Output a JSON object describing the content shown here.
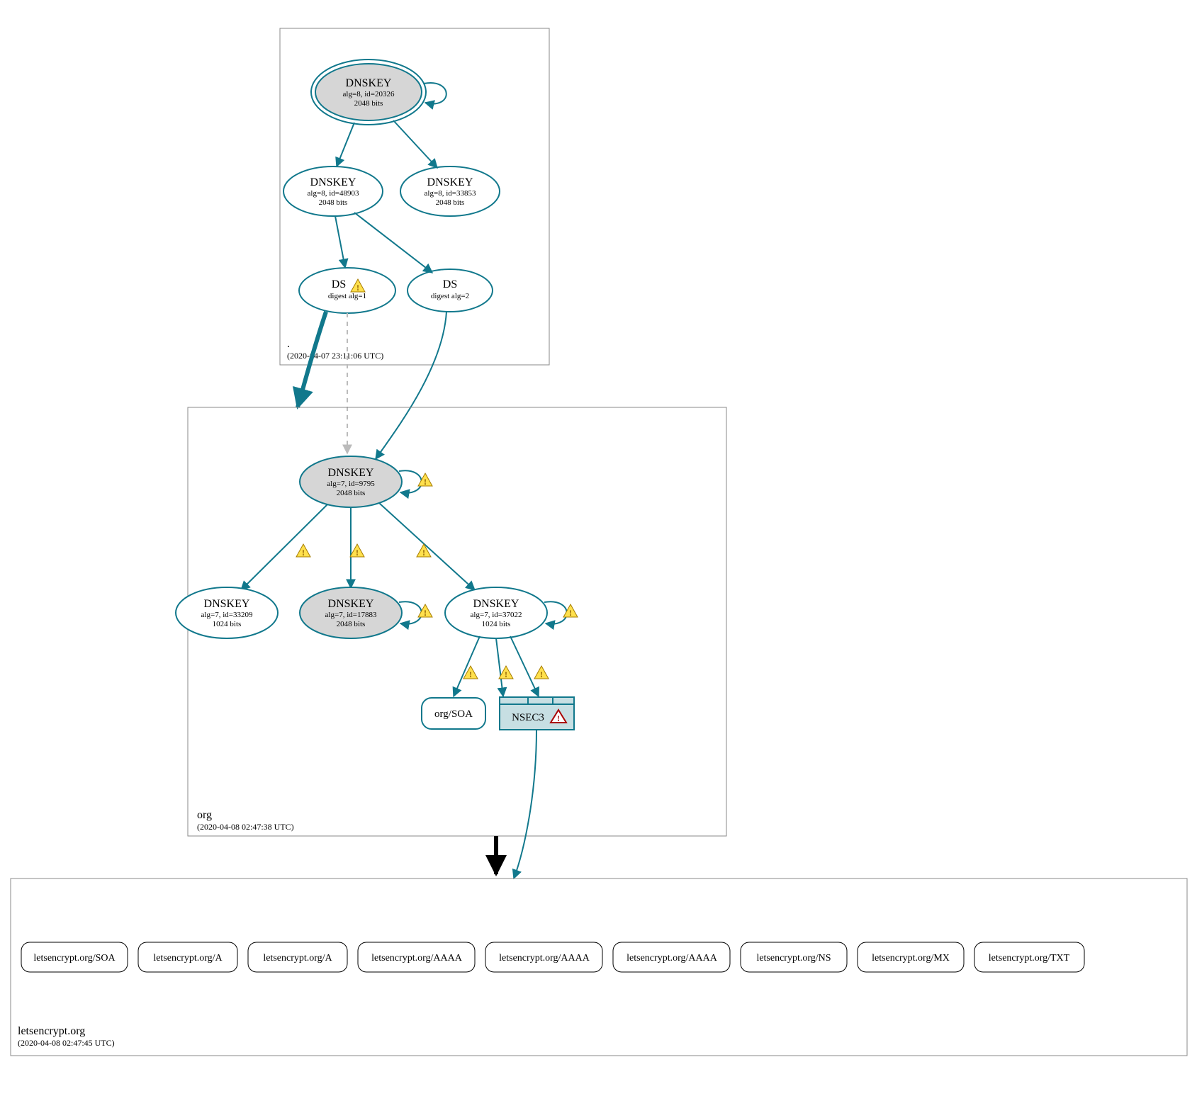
{
  "zones": {
    "root": {
      "label": ".",
      "time": "(2020-04-07 23:11:06 UTC)"
    },
    "org": {
      "label": "org",
      "time": "(2020-04-08 02:47:38 UTC)"
    },
    "le": {
      "label": "letsencrypt.org",
      "time": "(2020-04-08 02:47:45 UTC)"
    }
  },
  "root_nodes": {
    "ksk": {
      "title": "DNSKEY",
      "sub1": "alg=8, id=20326",
      "sub2": "2048 bits"
    },
    "zsk1": {
      "title": "DNSKEY",
      "sub1": "alg=8, id=48903",
      "sub2": "2048 bits"
    },
    "zsk2": {
      "title": "DNSKEY",
      "sub1": "alg=8, id=33853",
      "sub2": "2048 bits"
    },
    "ds1": {
      "title": "DS",
      "sub1": "digest alg=1"
    },
    "ds2": {
      "title": "DS",
      "sub1": "digest alg=2"
    }
  },
  "org_nodes": {
    "ksk": {
      "title": "DNSKEY",
      "sub1": "alg=7, id=9795",
      "sub2": "2048 bits"
    },
    "z1": {
      "title": "DNSKEY",
      "sub1": "alg=7, id=33209",
      "sub2": "1024 bits"
    },
    "z2": {
      "title": "DNSKEY",
      "sub1": "alg=7, id=17883",
      "sub2": "2048 bits"
    },
    "z3": {
      "title": "DNSKEY",
      "sub1": "alg=7, id=37022",
      "sub2": "1024 bits"
    },
    "soa": {
      "title": "org/SOA"
    },
    "nsec3": {
      "title": "NSEC3"
    }
  },
  "le_records": [
    "letsencrypt.org/SOA",
    "letsencrypt.org/A",
    "letsencrypt.org/A",
    "letsencrypt.org/AAAA",
    "letsencrypt.org/AAAA",
    "letsencrypt.org/AAAA",
    "letsencrypt.org/NS",
    "letsencrypt.org/MX",
    "letsencrypt.org/TXT"
  ],
  "colors": {
    "teal": "#11788c",
    "node_fill": "#d6d6d6",
    "warn": "#ffe04d",
    "err": "#a00"
  }
}
